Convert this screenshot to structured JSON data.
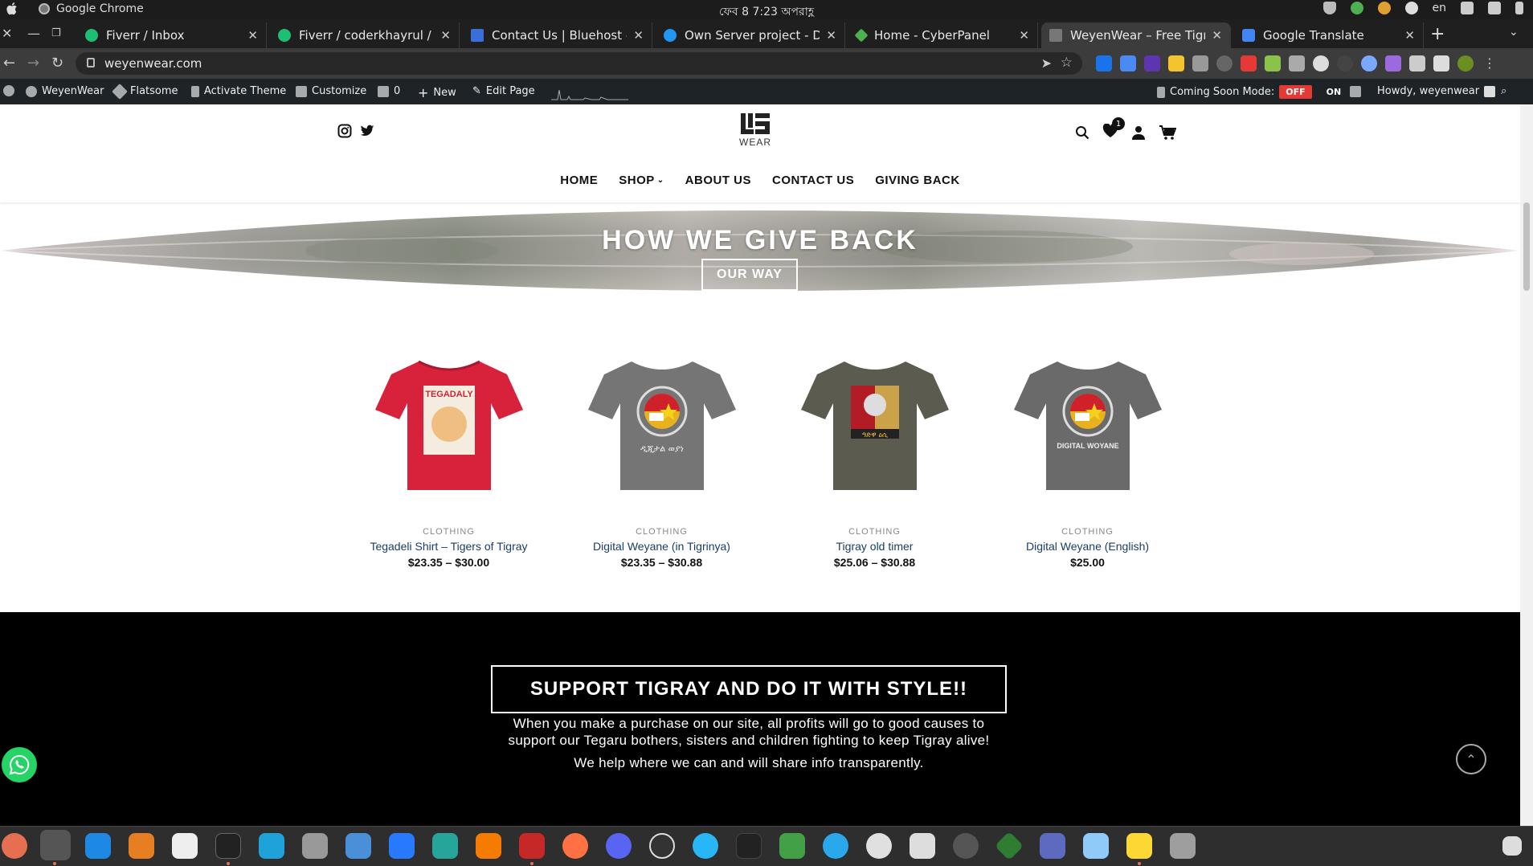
{
  "os_bar": {
    "app_name": "Google Chrome",
    "clock": "ফেব 8   7:23 অপরাহ্ণ",
    "lang": "en"
  },
  "tabs": [
    {
      "title": "Fiverr / Inbox",
      "color": "#1dbf73",
      "active": false
    },
    {
      "title": "Fiverr / coderkhayrul / Sh",
      "color": "#1dbf73",
      "active": false
    },
    {
      "title": "Contact Us | Bluehost - Bl",
      "color": "#3b6fd8",
      "active": false
    },
    {
      "title": "Own Server project - Digit",
      "color": "#2196f3",
      "active": false
    },
    {
      "title": "Home - CyberPanel",
      "color": "#4caf50",
      "active": false
    },
    {
      "title": "WeyenWear – Free Tigray!",
      "color": "#555555",
      "active": true
    },
    {
      "title": "Google Translate",
      "color": "#4285f4",
      "active": false
    }
  ],
  "address": {
    "url": "weyenwear.com"
  },
  "wp_admin": {
    "site": "WeyenWear",
    "theme": "Flatsome",
    "activate": "Activate Theme",
    "customize": "Customize",
    "comments": "0",
    "new": "New",
    "edit": "Edit Page",
    "coming_soon": "Coming Soon Mode:",
    "off": "OFF",
    "on": "ON",
    "howdy": "Howdy, weyenwear"
  },
  "header": {
    "logo_word": "WEAR",
    "wishlist_count": "1",
    "nav": [
      "HOME",
      "SHOP",
      "ABOUT US",
      "CONTACT US",
      "GIVING BACK"
    ]
  },
  "hero": {
    "title": "HOW WE GIVE BACK",
    "button": "OUR WAY"
  },
  "products": [
    {
      "category": "CLOTHING",
      "name": "Tegadeli Shirt – Tigers of Tigray",
      "price_from": "$23.35",
      "price_to": "$30.00",
      "shirt_color": "#d8213b"
    },
    {
      "category": "CLOTHING",
      "name": "Digital Weyane (in Tigrinya)",
      "price_from": "$23.35",
      "price_to": "$30.88",
      "shirt_color": "#757575"
    },
    {
      "category": "CLOTHING",
      "name": "Tigray old timer",
      "price_from": "$25.06",
      "price_to": "$30.88",
      "shirt_color": "#5b5b50"
    },
    {
      "category": "CLOTHING",
      "name": "Digital Weyane (English)",
      "price_from": "$25.00",
      "price_to": "",
      "shirt_color": "#6a6a6a"
    }
  ],
  "support": {
    "heading": "SUPPORT TIGRAY AND DO IT WITH STYLE!!",
    "line1": "When you make a purchase on our site, all profits will go to good causes to",
    "line2": "support our Tegaru bothers, sisters and children fighting to keep Tigray alive!",
    "line3": "We help where we can and will share info transparently."
  },
  "colors": {
    "accent_off": "#e53935",
    "whatsapp": "#25d366",
    "link": "#1a3d66"
  }
}
